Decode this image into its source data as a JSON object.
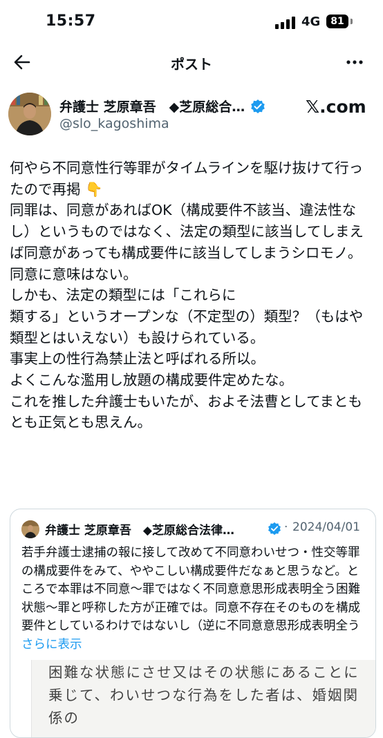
{
  "status_bar": {
    "time": "15:57",
    "network": "4G",
    "battery": "81"
  },
  "nav": {
    "title": "ポスト",
    "back_icon": "arrow-left-icon",
    "more_icon": "ellipsis-icon"
  },
  "author": {
    "name": "弁護士 芝原章吾　◆芝原総合…",
    "handle": "@slo_kagoshima",
    "via": "𝕏.com"
  },
  "post": {
    "text": "何やら不同意性行等罪がタイムラインを駆け抜けて行ったので再掲 👇\n同罪は、同意があればOK（構成要件不該当、違法性なし）というものではなく、法定の類型に該当してしまえば同意があっても構成要件に該当してしまうシロモノ。\n同意に意味はない。\nしかも、法定の類型には「これらに\n類する」というオープンな（不定型の）類型？（もはや類型とはいえない）も設けられている。\n事実上の性行為禁止法と呼ばれる所以。\nよくこんな濫用し放題の構成要件定めたな。\nこれを推した弁護士もいたが、およそ法曹としてまともとも正気とも思えん。"
  },
  "quote": {
    "name": "弁護士 芝原章吾　◆芝原総合法律…",
    "separator": "·",
    "date": "2024/04/01",
    "text": "若手弁護士逮捕の報に接して改めて不同意わいせつ・性交等罪の構成要件をみて、ややこしい構成要件だなぁと思うなど。ところで本罪は不同意〜罪ではなく不同意意思形成表明全う困難状態〜罪と呼称した方が正確では。同意不存在そのものを構成要件としているわけではないし（逆に不同意意思形成表明全う",
    "more_link": "さらに表示",
    "image_text": "困難な状態にさせ又はその状態にあることに乗じて、わいせつな行為をした者は、婚姻関係の"
  },
  "colors": {
    "accent": "#1d9bf0",
    "secondary_text": "#536471",
    "border": "#cfd9de"
  }
}
